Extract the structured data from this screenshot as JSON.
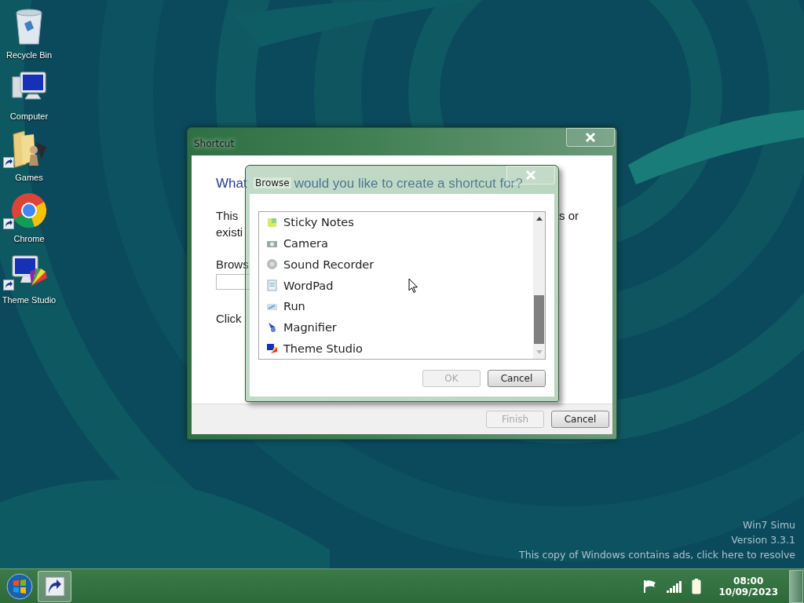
{
  "desktop": {
    "icons": [
      {
        "label": "Recycle Bin",
        "kind": "recycle",
        "shortcut": false
      },
      {
        "label": "Computer",
        "kind": "computer",
        "shortcut": false
      },
      {
        "label": "Games",
        "kind": "games",
        "shortcut": true
      },
      {
        "label": "Chrome",
        "kind": "browser",
        "shortcut": true
      },
      {
        "label": "Theme Studio",
        "kind": "theme",
        "shortcut": true
      }
    ],
    "notice": [
      "Win7 Simu",
      "Version 3.3.1",
      "This copy of Windows contains ads, click here to resolve"
    ]
  },
  "shortcut_window": {
    "title": "Shortcut",
    "heading": [
      "What",
      "would you like to create a shortcut for?"
    ],
    "description_lines": [
      {
        "left": "This",
        "right": "s or"
      },
      {
        "left": "existi"
      }
    ],
    "browse_label": "Brows",
    "hint": "Click",
    "buttons": [
      {
        "label": "Finish",
        "disabled": true
      },
      {
        "label": "Cancel",
        "disabled": false
      }
    ]
  },
  "browse_window": {
    "title": "Browse",
    "items": [
      {
        "label": "Sticky Notes",
        "kind": "sticky",
        "selected": false
      },
      {
        "label": "Camera",
        "kind": "camera",
        "selected": false
      },
      {
        "label": "Sound Recorder",
        "kind": "sound",
        "selected": false
      },
      {
        "label": "WordPad",
        "kind": "wordpad",
        "selected": false
      },
      {
        "label": "Run",
        "kind": "run",
        "selected": false
      },
      {
        "label": "Magnifier",
        "kind": "magnifier",
        "selected": false
      },
      {
        "label": "Theme Studio",
        "kind": "theme",
        "selected": false
      }
    ],
    "buttons": [
      {
        "label": "OK",
        "disabled": true
      },
      {
        "label": "Cancel",
        "disabled": false
      }
    ]
  },
  "taskbar": {
    "pinned": [
      {
        "kind": "shortcut",
        "active": true
      }
    ],
    "clock": {
      "time": "08:00",
      "date": "10/09/2023"
    }
  }
}
